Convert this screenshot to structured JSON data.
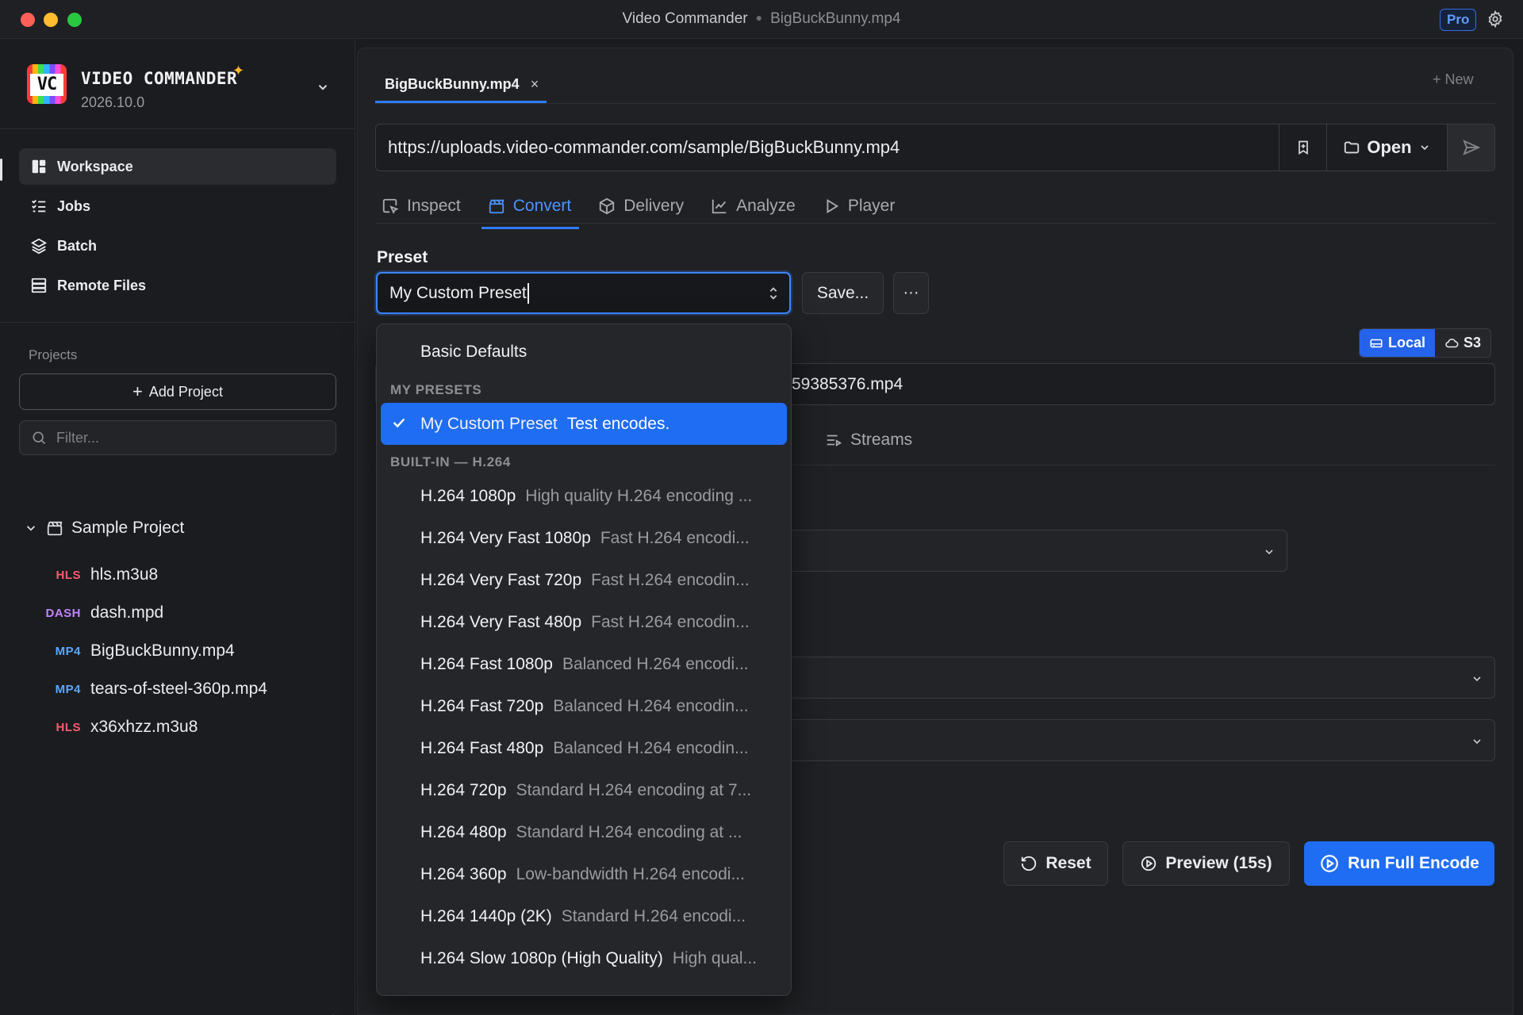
{
  "window": {
    "app_title": "Video Commander",
    "file_title": "BigBuckBunny.mp4",
    "pro_badge": "Pro"
  },
  "brand": {
    "name": "VIDEO COMMANDER",
    "logo_text": "VC",
    "version": "2026.10.0"
  },
  "nav": [
    {
      "label": "Workspace",
      "icon": "workspace-icon",
      "active": true
    },
    {
      "label": "Jobs",
      "icon": "jobs-icon"
    },
    {
      "label": "Batch",
      "icon": "layers-icon"
    },
    {
      "label": "Remote Files",
      "icon": "server-icon"
    }
  ],
  "projects": {
    "label": "Projects",
    "add_label": "Add Project",
    "filter_placeholder": "Filter...",
    "root": "Sample Project",
    "files": [
      {
        "type": "HLS",
        "name": "hls.m3u8"
      },
      {
        "type": "DASH",
        "name": "dash.mpd"
      },
      {
        "type": "MP4",
        "name": "BigBuckBunny.mp4"
      },
      {
        "type": "MP4",
        "name": "tears-of-steel-360p.mp4"
      },
      {
        "type": "HLS",
        "name": "x36xhzz.m3u8"
      }
    ]
  },
  "doc_tab": {
    "label": "BigBuckBunny.mp4",
    "close": "×",
    "new_label": "+ New"
  },
  "url_bar": {
    "url": "https://uploads.video-commander.com/sample/BigBuckBunny.mp4",
    "open_label": "Open"
  },
  "tabs": [
    {
      "label": "Inspect",
      "icon": "inspect-icon"
    },
    {
      "label": "Convert",
      "icon": "convert-icon",
      "active": true
    },
    {
      "label": "Delivery",
      "icon": "box-icon"
    },
    {
      "label": "Analyze",
      "icon": "chart-icon"
    },
    {
      "label": "Player",
      "icon": "play-icon"
    }
  ],
  "convert": {
    "preset_label": "Preset",
    "preset_value": "My Custom Preset",
    "save_label": "Save...",
    "more_label": "···",
    "storage_local": "Local",
    "storage_s3": "S3",
    "output_partial": "59385376.mp4",
    "streams_label": "Streams",
    "reset_label": "Reset",
    "preview_label": "Preview (15s)",
    "run_label": "Run Full Encode"
  },
  "dropdown": {
    "top_item": "Basic Defaults",
    "group_my": "MY PRESETS",
    "selected": {
      "name": "My Custom Preset",
      "desc": "Test encodes."
    },
    "group_builtin": "BUILT-IN — H.264",
    "items": [
      {
        "name": "H.264 1080p",
        "desc": "High quality H.264 encoding ..."
      },
      {
        "name": "H.264 Very Fast 1080p",
        "desc": "Fast H.264 encodi..."
      },
      {
        "name": "H.264 Very Fast 720p",
        "desc": "Fast H.264 encodin..."
      },
      {
        "name": "H.264 Very Fast 480p",
        "desc": "Fast H.264 encodin..."
      },
      {
        "name": "H.264 Fast 1080p",
        "desc": "Balanced H.264 encodi..."
      },
      {
        "name": "H.264 Fast 720p",
        "desc": "Balanced H.264 encodin..."
      },
      {
        "name": "H.264 Fast 480p",
        "desc": "Balanced H.264 encodin..."
      },
      {
        "name": "H.264 720p",
        "desc": "Standard H.264 encoding at 7..."
      },
      {
        "name": "H.264 480p",
        "desc": "Standard H.264 encoding at ..."
      },
      {
        "name": "H.264 360p",
        "desc": "Low-bandwidth H.264 encodi..."
      },
      {
        "name": "H.264 1440p (2K)",
        "desc": "Standard H.264 encodi..."
      },
      {
        "name": "H.264 Slow 1080p (High Quality)",
        "desc": "High qual..."
      }
    ]
  },
  "colors": {
    "accent": "#1f6df2",
    "hls": "#ff5a6e",
    "dash": "#c084fc",
    "mp4": "#5aa7ff",
    "pro": "#5f9bff"
  }
}
